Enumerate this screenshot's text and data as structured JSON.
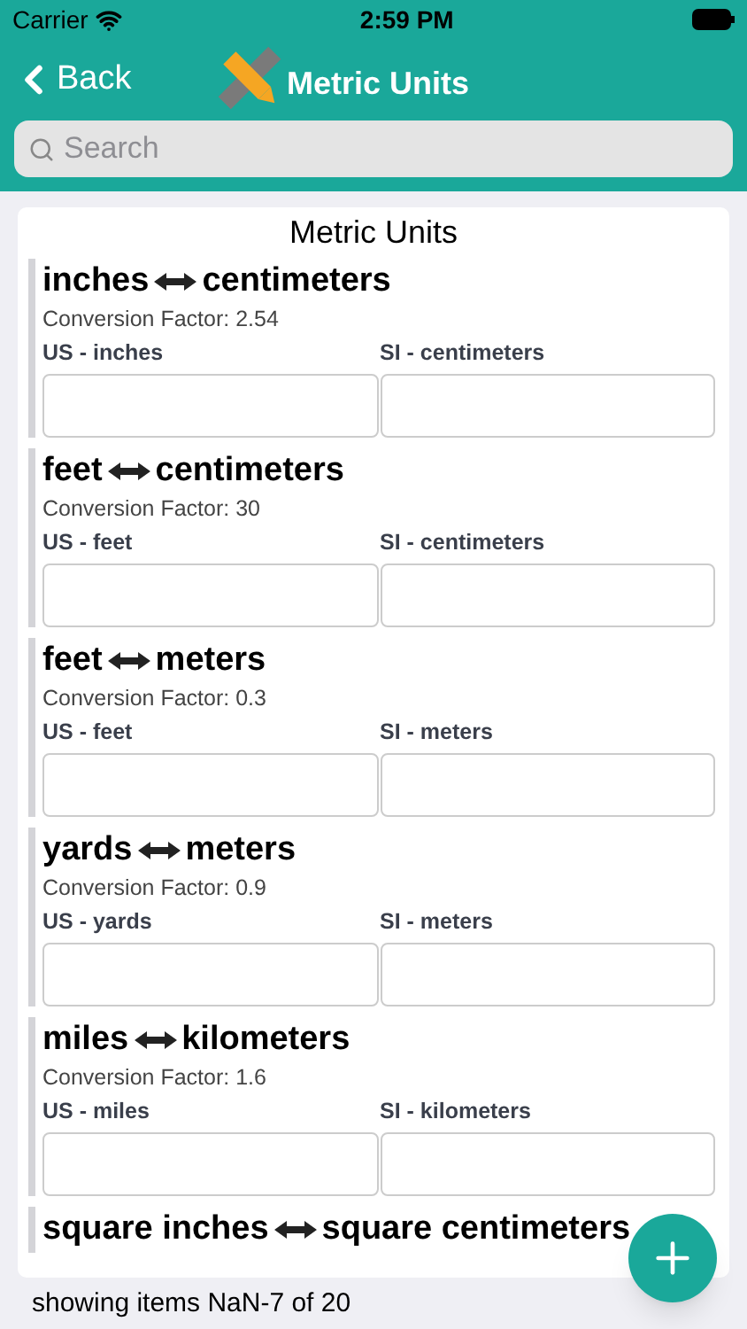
{
  "status_bar": {
    "carrier": "Carrier",
    "time": "2:59 PM"
  },
  "nav": {
    "back": "Back",
    "title": "Metric Units"
  },
  "search": {
    "placeholder": "Search"
  },
  "card_title": "Metric Units",
  "conversions": [
    {
      "from": "inches",
      "to": "centimeters",
      "factor": "Conversion Factor: 2.54",
      "us_label": "US - inches",
      "si_label": "SI - centimeters"
    },
    {
      "from": "feet",
      "to": "centimeters",
      "factor": "Conversion Factor: 30",
      "us_label": "US - feet",
      "si_label": "SI - centimeters"
    },
    {
      "from": "feet",
      "to": "meters",
      "factor": "Conversion Factor: 0.3",
      "us_label": "US - feet",
      "si_label": "SI - meters"
    },
    {
      "from": "yards",
      "to": "meters",
      "factor": "Conversion Factor: 0.9",
      "us_label": "US - yards",
      "si_label": "SI - meters"
    },
    {
      "from": "miles",
      "to": "kilometers",
      "factor": "Conversion Factor: 1.6",
      "us_label": "US - miles",
      "si_label": "SI - kilometers"
    },
    {
      "from": "square inches",
      "to": "square centimeters"
    }
  ],
  "footer": "showing items NaN-7 of 20"
}
